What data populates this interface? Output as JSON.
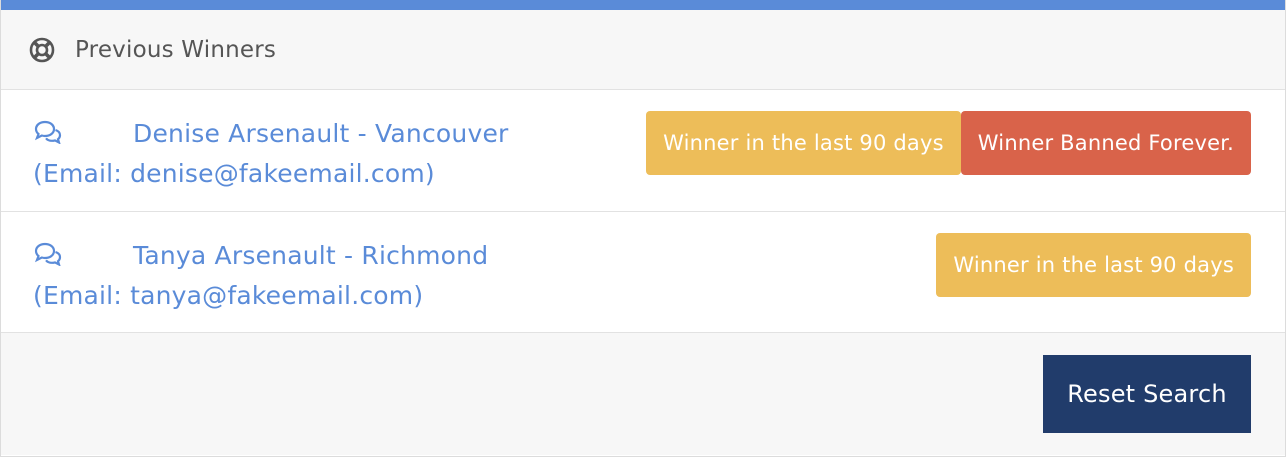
{
  "header": {
    "icon": "life-ring-icon",
    "title": "Previous Winners"
  },
  "winners": [
    {
      "icon": "comments-icon",
      "name": "Denise Arsenault - Vancouver",
      "email_line": "(Email: denise@fakeemail.com)",
      "badges": [
        "Winner in the last 90 days",
        "Winner Banned Forever."
      ]
    },
    {
      "icon": "comments-icon",
      "name": "Tanya Arsenault - Richmond",
      "email_line": "(Email: tanya@fakeemail.com)",
      "badges": [
        "Winner in the last 90 days"
      ]
    }
  ],
  "footer": {
    "reset_label": "Reset Search"
  },
  "colors": {
    "accent_top_bar": "#5a8bd8",
    "link": "#5a8bd8",
    "badge_warning": "#edbd59",
    "badge_danger": "#d9634a",
    "button_primary": "#213c6b"
  }
}
